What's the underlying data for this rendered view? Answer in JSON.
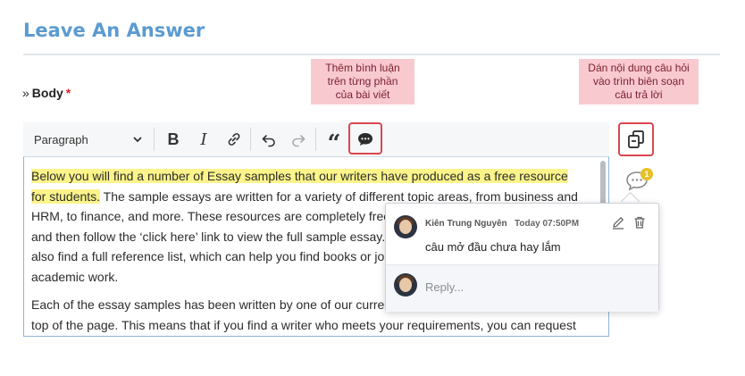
{
  "page": {
    "title": "Leave An Answer"
  },
  "field": {
    "label": "Body",
    "required_mark": "*",
    "label_prefix": "»"
  },
  "callouts": {
    "comment": [
      "Thêm bình luận",
      "trên từng phần",
      "của bài viết"
    ],
    "paste": [
      "Dán nội dung câu hỏi",
      "vào trình biên soạn",
      "câu trả lời"
    ]
  },
  "toolbar": {
    "format_value": "Paragraph",
    "icons": [
      "chevron-down-icon",
      "bold-icon",
      "italic-icon",
      "link-icon",
      "undo-icon",
      "redo-icon",
      "blockquote-icon",
      "comment-icon"
    ],
    "bold": "B",
    "italic": "I",
    "quote": "“"
  },
  "editor": {
    "p1_highlight": "Below you will find a number of Essay samples that our writers have produced as a free resource for students.",
    "p1_rest": " The sample essays are written for a variety of different topic areas, from business and HRM, to finance, and more. These resources are completely free, and you can click to expand it and then follow the ‘click here’ link to view the full sample essay. With each sample essay, you will also find a full reference list, which can help you find books or journals to use for your own academic work.",
    "p2": "Each of the essay samples has been written by one of our current writers – they are specified at the top of the page. This means that if you find a writer who meets your requirements, you can request"
  },
  "side": {
    "comment_count": "1"
  },
  "comment": {
    "author": "Kiên Trung Nguyên",
    "time": "Today 07:50PM",
    "text": "câu mở đầu chưa hay lắm",
    "reply_placeholder": "Reply..."
  },
  "colors": {
    "title": "#5b9bd1",
    "highlight": "#fbf48a",
    "callout_bg": "#f8c9cf",
    "callout_border": "#d9474f",
    "badge": "#e6c229"
  }
}
